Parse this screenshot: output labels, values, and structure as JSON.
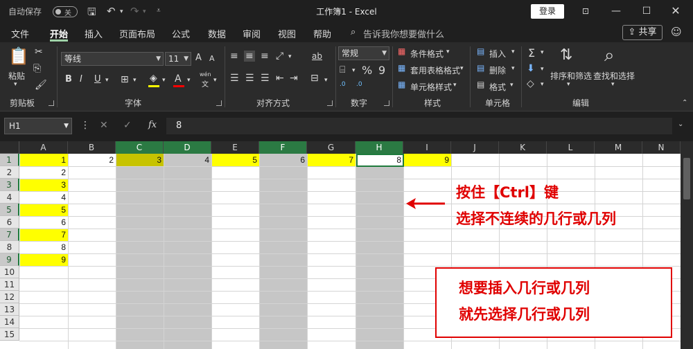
{
  "titlebar": {
    "autosave_label": "自动保存",
    "autosave_state": "关",
    "title": "工作簿1 - Excel",
    "login": "登录"
  },
  "menu": {
    "items": [
      "文件",
      "开始",
      "插入",
      "页面布局",
      "公式",
      "数据",
      "审阅",
      "视图",
      "帮助"
    ],
    "active": "开始",
    "tell_me": "告诉我你想要做什么",
    "share": "共享"
  },
  "ribbon": {
    "clipboard": {
      "paste": "粘贴",
      "label": "剪贴板"
    },
    "font": {
      "name": "等线",
      "size": "11",
      "grow": "A",
      "shrink": "A",
      "bold": "B",
      "italic": "I",
      "underline": "U",
      "label": "字体",
      "wen": "wén",
      "wen_char": "文"
    },
    "align": {
      "label": "对齐方式",
      "wrap": "ab"
    },
    "number": {
      "format": "常规",
      "percent": "%",
      "comma": "9",
      "inc": ".0",
      "label": "数字"
    },
    "styles": {
      "cond": "条件格式",
      "table": "套用表格格式",
      "cell": "单元格样式",
      "label": "样式"
    },
    "cells": {
      "insert": "插入",
      "delete": "删除",
      "format": "格式",
      "label": "单元格"
    },
    "edit": {
      "sigma": "Σ",
      "sort": "排序和筛选",
      "find": "查找和选择",
      "label": "编辑"
    }
  },
  "formula_bar": {
    "name_box": "H1",
    "value": "8",
    "fx": "fx"
  },
  "sheet": {
    "columns": [
      "A",
      "B",
      "C",
      "D",
      "E",
      "F",
      "G",
      "H",
      "I",
      "J",
      "K",
      "L",
      "M",
      "N"
    ],
    "selected_columns": [
      "C",
      "D",
      "F",
      "H"
    ],
    "rows": [
      "1",
      "2",
      "3",
      "4",
      "5",
      "6",
      "7",
      "8",
      "9",
      "10",
      "11",
      "12",
      "13",
      "14",
      "15"
    ],
    "selected_rows": [
      "1",
      "3",
      "5",
      "7",
      "9"
    ],
    "row1_values": [
      "1",
      "2",
      "3",
      "4",
      "5",
      "6",
      "7",
      "8",
      "9"
    ],
    "colA_values": [
      "1",
      "2",
      "3",
      "4",
      "5",
      "6",
      "7",
      "8",
      "9"
    ],
    "active_cell": "H1"
  },
  "annotations": {
    "line1": "按住【Ctrl】键",
    "line2": "选择不连续的几行或几列",
    "box_line1": "想要插入几行或几列",
    "box_line2": "就先选择几行或几列"
  },
  "colors": {
    "accent": "#2b7a43",
    "highlight_yellow": "#ffff00",
    "selection_gray": "#c6c6c6",
    "annotation_red": "#e00000"
  }
}
